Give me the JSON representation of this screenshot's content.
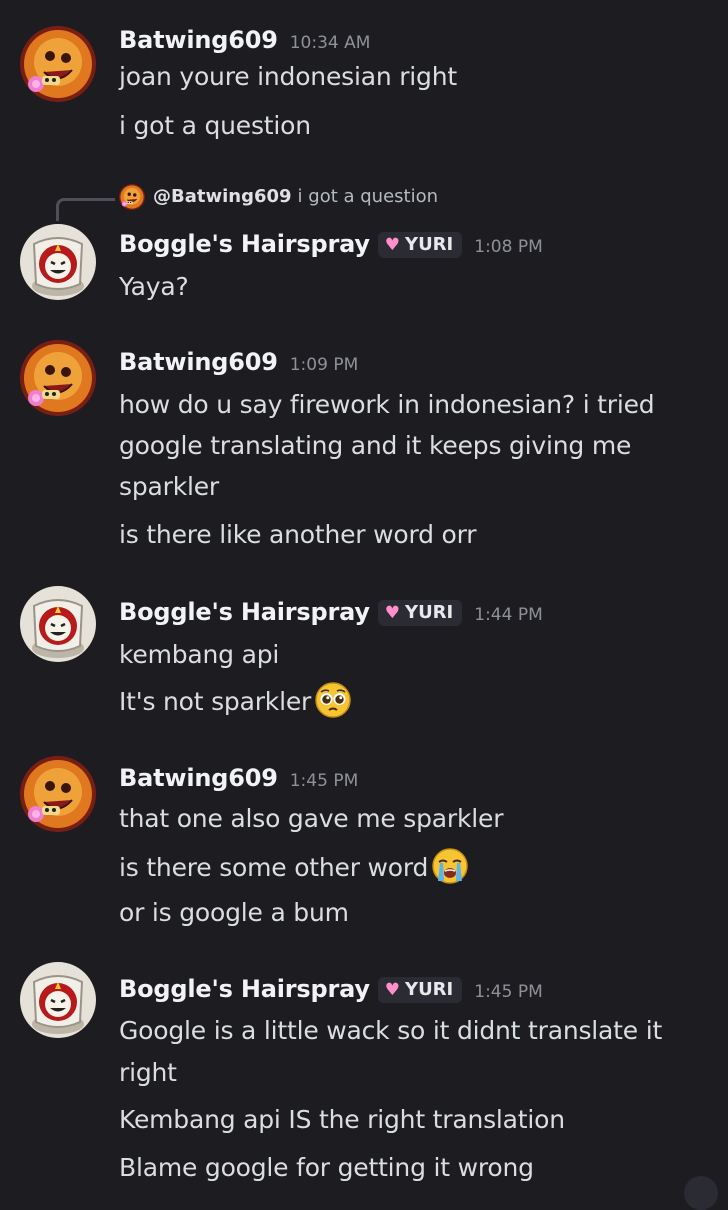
{
  "users": {
    "batwing": {
      "name": "Batwing609"
    },
    "boggle": {
      "name": "Boggle's Hairspray",
      "tag": "YURI",
      "tag_icon": "heart-icon"
    }
  },
  "reply": {
    "mention": "@Batwing609",
    "text": "i got a question"
  },
  "groups": [
    {
      "time": "10:34 AM",
      "lines": [
        "joan youre indonesian right",
        "i got a question"
      ]
    },
    {
      "time": "1:08 PM",
      "lines": [
        "Yaya?"
      ]
    },
    {
      "time": "1:09 PM",
      "lines": [
        "how do u say firework in indonesian? i tried",
        "google translating and it keeps giving me",
        "sparkler",
        "is there like another word orr"
      ]
    },
    {
      "time": "1:44 PM",
      "lines": [
        "kembang api",
        "It's not sparkler"
      ]
    },
    {
      "time": "1:45 PM",
      "lines": [
        "that one also gave me sparkler",
        "is there some other word",
        "or is google a bum"
      ]
    },
    {
      "time": "1:45 PM",
      "lines": [
        "Google is a little wack so it didnt translate it",
        "right",
        "Kembang api IS the right translation",
        "Blame google for getting it wrong"
      ]
    }
  ],
  "colors": {
    "background": "#1c1c21",
    "username": "#f2f3f5",
    "message_text": "#dbdee1",
    "timestamp": "#8e9297",
    "tag_bg": "#2b2c33",
    "tag_heart": "#ff8fc8"
  }
}
